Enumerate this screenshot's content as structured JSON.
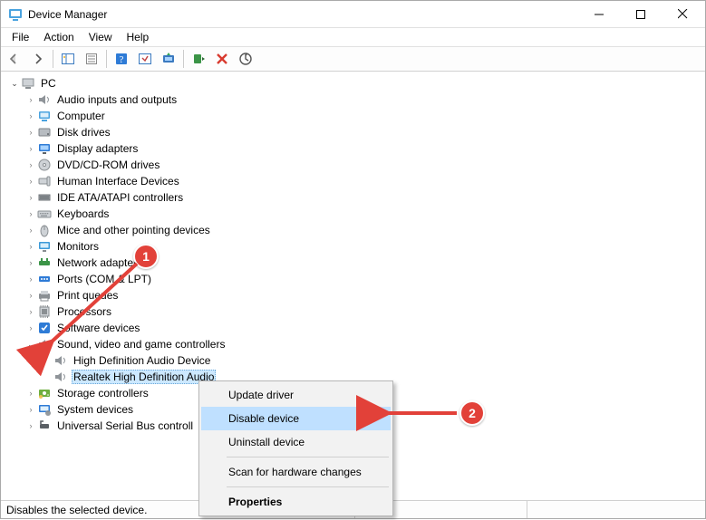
{
  "titlebar": {
    "title": "Device Manager"
  },
  "menubar": {
    "items": [
      "File",
      "Action",
      "View",
      "Help"
    ]
  },
  "tree": {
    "root": {
      "label": "PC",
      "expanded": true
    },
    "categories": [
      {
        "label": "Audio inputs and outputs",
        "icon": "speaker"
      },
      {
        "label": "Computer",
        "icon": "computer"
      },
      {
        "label": "Disk drives",
        "icon": "disk"
      },
      {
        "label": "Display adapters",
        "icon": "display"
      },
      {
        "label": "DVD/CD-ROM drives",
        "icon": "dvd"
      },
      {
        "label": "Human Interface Devices",
        "icon": "hid"
      },
      {
        "label": "IDE ATA/ATAPI controllers",
        "icon": "ide"
      },
      {
        "label": "Keyboards",
        "icon": "keyboard"
      },
      {
        "label": "Mice and other pointing devices",
        "icon": "mouse"
      },
      {
        "label": "Monitors",
        "icon": "monitor"
      },
      {
        "label": "Network adapters",
        "icon": "network"
      },
      {
        "label": "Ports (COM & LPT)",
        "icon": "port"
      },
      {
        "label": "Print queues",
        "icon": "printer"
      },
      {
        "label": "Processors",
        "icon": "cpu"
      },
      {
        "label": "Software devices",
        "icon": "software"
      },
      {
        "label": "Sound, video and game controllers",
        "icon": "speaker",
        "expanded": true,
        "children": [
          {
            "label": "High Definition Audio Device",
            "icon": "speaker"
          },
          {
            "label": "Realtek High Definition Audio",
            "icon": "speaker",
            "selected": true
          }
        ]
      },
      {
        "label": "Storage controllers",
        "icon": "storage"
      },
      {
        "label": "System devices",
        "icon": "system"
      },
      {
        "label": "Universal Serial Bus controllers",
        "icon": "truncated",
        "label_truncated": "Universal Serial Bus controll"
      }
    ]
  },
  "ctx_menu": {
    "items": [
      {
        "label": "Update driver"
      },
      {
        "label": "Disable device",
        "hovered": true
      },
      {
        "label": "Uninstall device"
      },
      {
        "separator": true
      },
      {
        "label": "Scan for hardware changes"
      },
      {
        "separator": true
      },
      {
        "label": "Properties",
        "bold": true
      }
    ]
  },
  "statusbar": {
    "text": "Disables the selected device."
  },
  "annotations": {
    "badge1": "1",
    "badge2": "2"
  }
}
